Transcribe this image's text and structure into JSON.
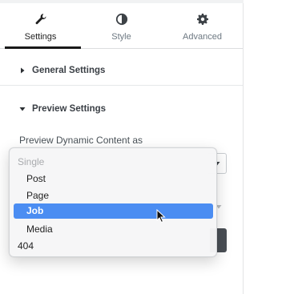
{
  "tabs": [
    {
      "label": "Settings",
      "icon": "wrench-icon",
      "active": true
    },
    {
      "label": "Style",
      "icon": "half-circle-icon",
      "active": false
    },
    {
      "label": "Advanced",
      "icon": "gear-icon",
      "active": false
    }
  ],
  "sections": {
    "general": {
      "title": "General Settings",
      "expanded": false
    },
    "preview": {
      "title": "Preview Settings",
      "expanded": true
    }
  },
  "preview_field": {
    "label": "Preview Dynamic Content as"
  },
  "dropdown": {
    "group_label": "Single",
    "options": [
      "Post",
      "Page",
      "Job",
      "Media"
    ],
    "selected": "Job",
    "extra_option": "404"
  },
  "colors": {
    "accent": "#4b8df2",
    "text": "#3a3f45",
    "muted": "#6d7882"
  }
}
